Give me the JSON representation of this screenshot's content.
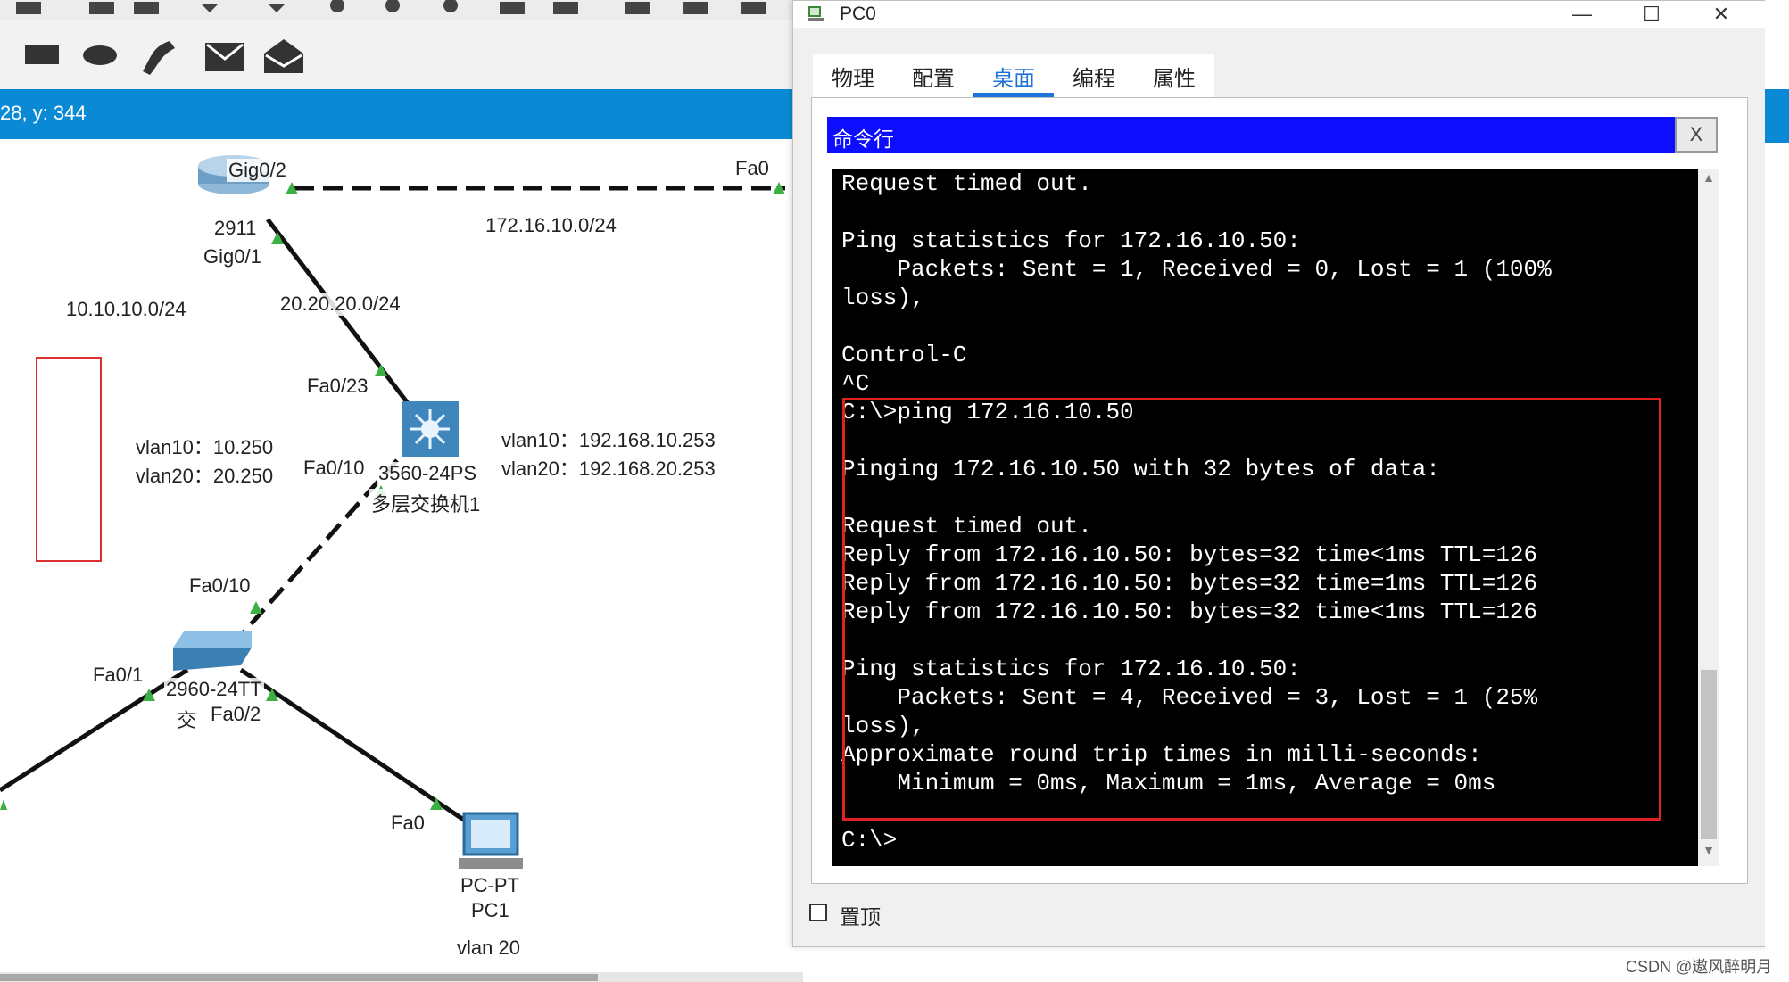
{
  "workspace": {
    "coord_text": "28, y: 344",
    "labels": {
      "gig0_2": "Gig0/2",
      "fa0_top": "Fa0",
      "net_172": "172.16.10.0/24",
      "router_model": "2911",
      "gig0_1": "Gig0/1",
      "net_10": "10.10.10.0/24",
      "net_20": "20.20.20.0/24",
      "fa0_23": "Fa0/23",
      "vlan10_left": "vlan10：10.250",
      "vlan20_left": "vlan20：20.250",
      "fa0_10_upper": "Fa0/10",
      "l3_model": "3560-24PS",
      "l3_name": "多层交换机1",
      "vlan10_right": "vlan10：192.168.10.253",
      "vlan20_right": "vlan20：192.168.20.253",
      "fa0_10_lower": "Fa0/10",
      "fa0_1": "Fa0/1",
      "l2_model": "2960-24TT",
      "l2_name_partial": "交",
      "fa0_2": "Fa0/2",
      "fa0_pc": "Fa0",
      "pc_model": "PC-PT",
      "pc_name": "PC1",
      "pc_vlan": "vlan 20"
    }
  },
  "window": {
    "title": "PC0",
    "controls": {
      "minimize": "—",
      "maximize": "☐",
      "close": "✕"
    },
    "tabs": [
      {
        "label": "物理",
        "active": false
      },
      {
        "label": "配置",
        "active": false
      },
      {
        "label": "桌面",
        "active": true
      },
      {
        "label": "编程",
        "active": false
      },
      {
        "label": "属性",
        "active": false
      }
    ],
    "cmd": {
      "title": "命令行",
      "close_label": "X",
      "lines": [
        "Request timed out.",
        "",
        "Ping statistics for 172.16.10.50:",
        "    Packets: Sent = 1, Received = 0, Lost = 1 (100%",
        "loss),",
        "",
        "Control-C",
        "^C",
        "C:\\>ping 172.16.10.50",
        "",
        "Pinging 172.16.10.50 with 32 bytes of data:",
        "",
        "Request timed out.",
        "Reply from 172.16.10.50: bytes=32 time<1ms TTL=126",
        "Reply from 172.16.10.50: bytes=32 time=1ms TTL=126",
        "Reply from 172.16.10.50: bytes=32 time<1ms TTL=126",
        "",
        "Ping statistics for 172.16.10.50:",
        "    Packets: Sent = 4, Received = 3, Lost = 1 (25%",
        "loss),",
        "Approximate round trip times in milli-seconds:",
        "    Minimum = 0ms, Maximum = 1ms, Average = 0ms",
        "",
        "C:\\>"
      ]
    },
    "pin_label": "置顶"
  },
  "watermark": "CSDN @遨风醉明月",
  "colors": {
    "accent_blue": "#0a8ad4",
    "cmd_header_blue": "#0d0dff",
    "tab_active": "#1e73d8",
    "highlight_red": "#e02222",
    "link_green": "#3cb043"
  },
  "icons": {
    "window_icon": "packet-tracer-pc-icon",
    "router": "router-icon",
    "multilayer_switch": "multilayer-switch-icon",
    "switch": "switch-icon",
    "pc": "pc-icon"
  }
}
